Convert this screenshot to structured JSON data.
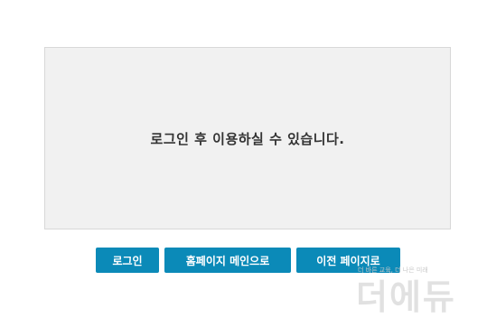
{
  "message": {
    "text": "로그인 후 이용하실 수 있습니다."
  },
  "buttons": {
    "login_label": "로그인",
    "home_label": "홈페이지 메인으로",
    "prev_label": "이전 페이지로"
  },
  "watermark": {
    "small_text": "더 바른 교육, 더 나은 미래",
    "logo_text": "더에듀"
  },
  "colors": {
    "button_bg": "#0b8ab8",
    "box_bg": "#f1f1f1"
  }
}
